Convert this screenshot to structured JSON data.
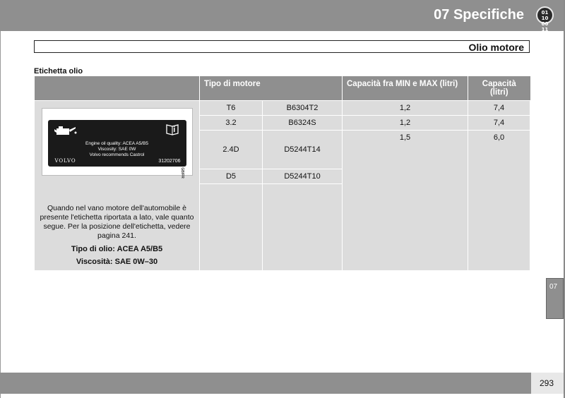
{
  "header": {
    "chapter_title": "07 Specifiche",
    "icon_lines": [
      "01 10",
      "00 11"
    ]
  },
  "section": {
    "title": "Olio motore"
  },
  "label_heading": "Etichetta olio",
  "table": {
    "headers": [
      "Tipo di motore",
      "Capacità fra MIN e MAX (litri)",
      "Capacità (litri)"
    ],
    "rows": [
      {
        "engine": "T6",
        "code": "B6304T2",
        "min_max": "1,2",
        "capacity": "7,4"
      },
      {
        "engine": "3.2",
        "code": "B6324S",
        "min_max": "1,2",
        "capacity": "7,4"
      },
      {
        "engine": "2.4D",
        "code": "D5244T14",
        "min_max": "1,5",
        "capacity": "6,0"
      },
      {
        "engine": "D5",
        "code": "D5244T10",
        "min_max": "",
        "capacity": ""
      }
    ]
  },
  "oil_label": {
    "lines": [
      "Engine oil quality: ACEA A5/B5",
      "Viscosity: SAE 0W",
      "Volvo recommends Castrol"
    ],
    "brand": "VOLVO",
    "part_number": "31202706",
    "side_code": "GB/FR"
  },
  "description": "Quando nel vano motore dell'automobile è presente l'etichetta riportata a lato, vale quanto segue. Per la posizione dell'etichetta, vedere pagina 241.",
  "oil_type": "Tipo di olio: ACEA A5/B5",
  "viscosity": "Viscosità: SAE 0W–30",
  "side_tab": "07",
  "page_number": "293"
}
